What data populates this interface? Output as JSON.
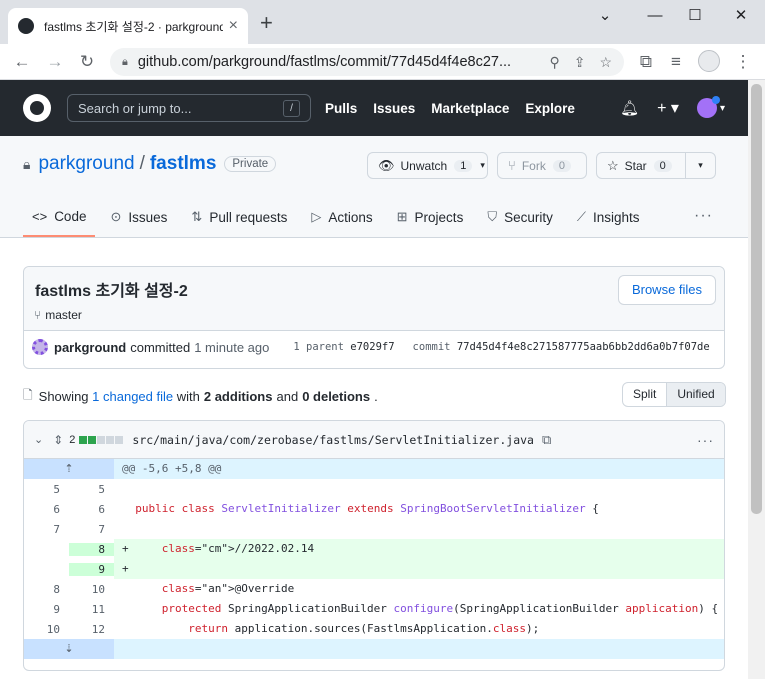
{
  "browser": {
    "tab_title": "fastlms 초기화 설정-2 · parkground",
    "url": "github.com/parkground/fastlms/commit/77d45d4f4e8c27..."
  },
  "gh": {
    "search_placeholder": "Search or jump to...",
    "search_key": "/",
    "nav": [
      "Pulls",
      "Issues",
      "Marketplace",
      "Explore"
    ]
  },
  "repo": {
    "owner": "parkground",
    "sep": "/",
    "name": "fastlms",
    "visibility": "Private",
    "watch_label": "Unwatch",
    "watch_count": "1",
    "fork_label": "Fork",
    "fork_count": "0",
    "star_label": "Star",
    "star_count": "0",
    "tabs": [
      "Code",
      "Issues",
      "Pull requests",
      "Actions",
      "Projects",
      "Security",
      "Insights"
    ]
  },
  "commit": {
    "title": "fastlms 초기화 설정-2",
    "branch": "master",
    "browse_label": "Browse files",
    "author": "parkground",
    "action": "committed",
    "time": "1 minute ago",
    "parent_label": "1 parent",
    "parent_sha": "e7029f7",
    "commit_label": "commit",
    "sha": "77d45d4f4e8c271587775aab6bb2dd6a0b7f07de"
  },
  "stats": {
    "showing": "Showing",
    "changed": "1 changed file",
    "with": "with",
    "additions": "2 additions",
    "and": "and",
    "deletions": "0 deletions",
    "period": ".",
    "split_label": "Split",
    "unified_label": "Unified"
  },
  "file": {
    "change_count": "2",
    "path": "src/main/java/com/zerobase/fastlms/ServletInitializer.java",
    "hunk": "@@ -5,6 +5,8 @@",
    "lines": [
      {
        "old": "5",
        "new": "5",
        "type": "ctx",
        "text": ""
      },
      {
        "old": "6",
        "new": "6",
        "type": "ctx",
        "text": "public class ServletInitializer extends SpringBootServletInitializer {"
      },
      {
        "old": "7",
        "new": "7",
        "type": "ctx",
        "text": ""
      },
      {
        "old": "",
        "new": "8",
        "type": "add",
        "text": "    //2022.02.14"
      },
      {
        "old": "",
        "new": "9",
        "type": "add",
        "text": ""
      },
      {
        "old": "8",
        "new": "10",
        "type": "ctx",
        "text": "    @Override"
      },
      {
        "old": "9",
        "new": "11",
        "type": "ctx",
        "text": "    protected SpringApplicationBuilder configure(SpringApplicationBuilder application) {"
      },
      {
        "old": "10",
        "new": "12",
        "type": "ctx",
        "text": "        return application.sources(FastlmsApplication.class);"
      }
    ]
  }
}
